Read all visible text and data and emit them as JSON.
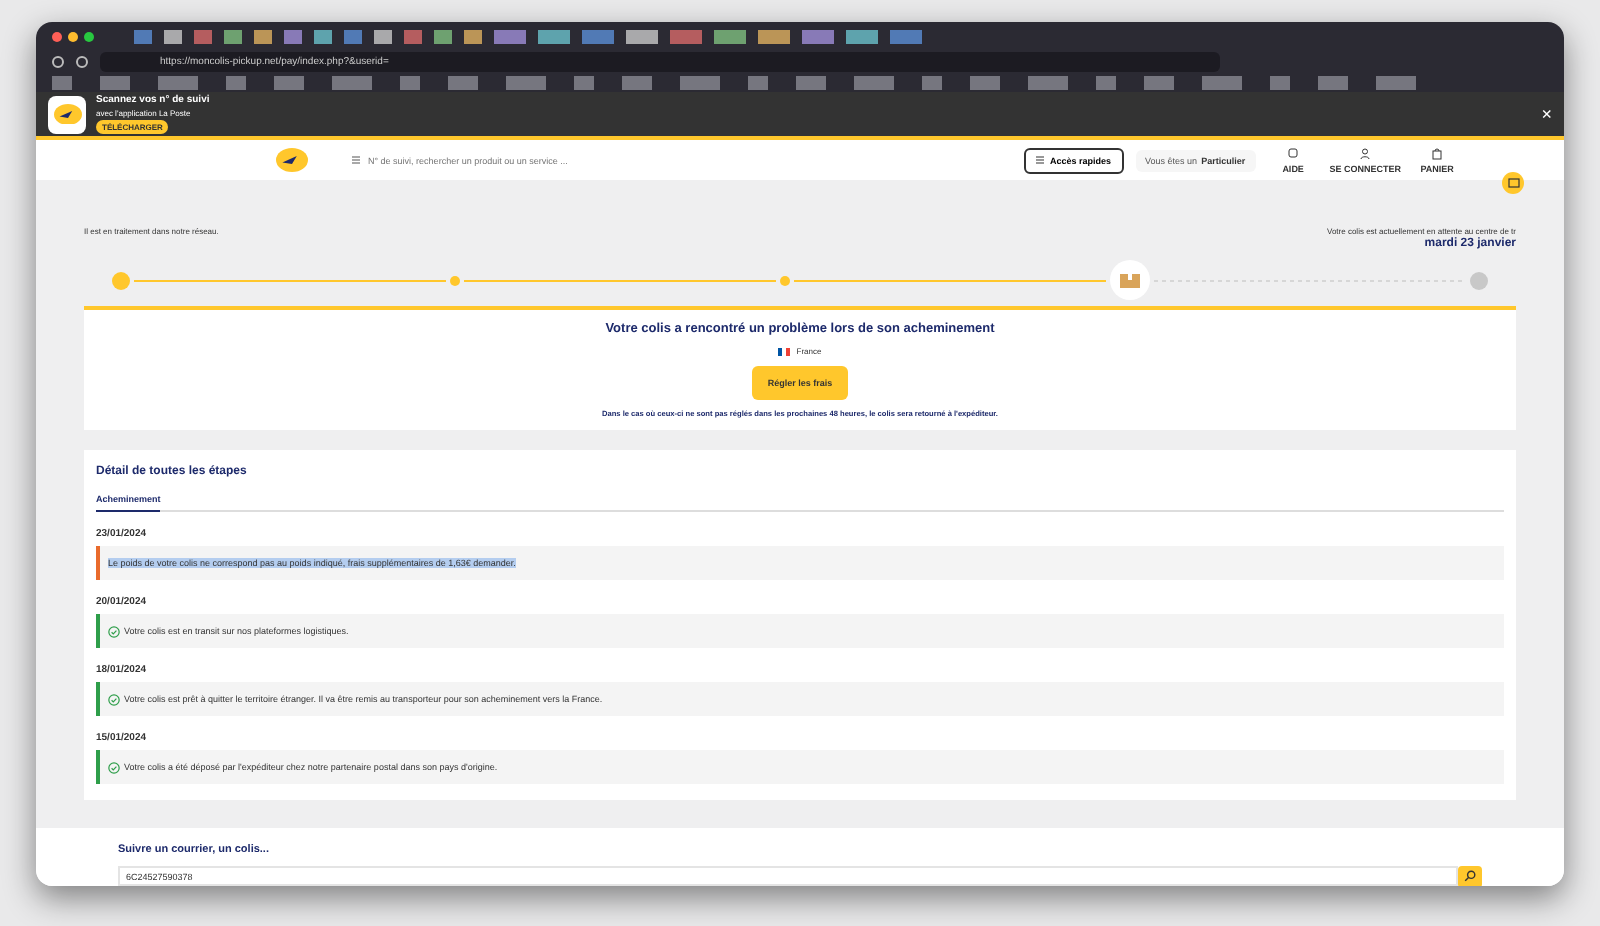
{
  "browser": {
    "url": "https://moncolis-pickup.net/pay/index.php?&userid="
  },
  "app_banner": {
    "title": "Scannez vos n° de suivi",
    "subtitle": "avec l'application La Poste",
    "badge": "TÉLÉCHARGER",
    "close": "×"
  },
  "header": {
    "search": {
      "placeholder": "N° de suivi, rechercher un produit ou un service ..."
    },
    "quick_access": "Accès rapides",
    "profile_prefix": "Vous êtes un",
    "profile": "Particulier",
    "actions": [
      {
        "kind": "help",
        "label": "AIDE"
      },
      {
        "kind": "user",
        "label": "SE CONNECTER"
      },
      {
        "kind": "cart",
        "label": "PANIER"
      }
    ]
  },
  "status": {
    "left": "Il est en traitement dans notre réseau.",
    "right": "Votre colis est actuellement en attente au centre de tr",
    "date": "mardi 23 janvier"
  },
  "progress": [
    {
      "reached": true,
      "current": false
    },
    {
      "reached": true,
      "current": false
    },
    {
      "reached": true,
      "current": false
    },
    {
      "reached": true,
      "current": true
    },
    {
      "reached": false,
      "current": false
    }
  ],
  "problem": {
    "title": "Votre colis a rencontré un problème lors de son acheminement",
    "country": "France",
    "button": "Régler les frais",
    "note": "Dans le cas où ceux-ci ne sont pas réglés dans les prochaines 48 heures, le colis sera retourné à l'expéditeur."
  },
  "details": {
    "title": "Détail de toutes les étapes",
    "tabs": [
      {
        "label": "Acheminement",
        "selected": true
      }
    ],
    "steps": [
      {
        "date": "23/01/2024",
        "kind": "warning",
        "highlighted": true,
        "text": "Le poids de votre colis ne correspond pas au poids indiqué, frais supplémentaires de 1,63€ demander."
      },
      {
        "date": "20/01/2024",
        "kind": "done",
        "highlighted": false,
        "text": "Votre colis est en transit sur nos plateformes logistiques."
      },
      {
        "date": "18/01/2024",
        "kind": "done",
        "highlighted": false,
        "text": "Votre colis est prêt à quitter le territoire étranger. Il va être remis au transporteur pour son acheminement vers la France."
      },
      {
        "date": "15/01/2024",
        "kind": "done",
        "highlighted": false,
        "text": "Votre colis a été déposé par l'expéditeur chez notre partenaire postal dans son pays d'origine."
      }
    ]
  },
  "track": {
    "title": "Suivre un courrier, un colis...",
    "value": "6C24527590378"
  }
}
